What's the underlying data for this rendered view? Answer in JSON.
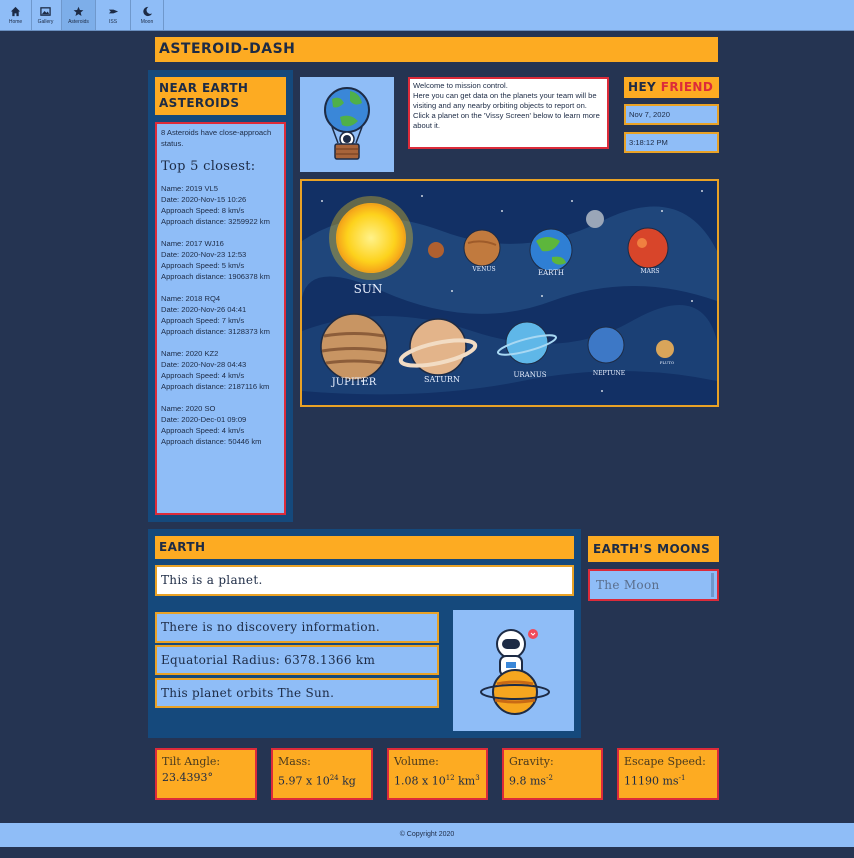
{
  "nav": {
    "items": [
      {
        "label": "Home",
        "icon": "home-icon"
      },
      {
        "label": "Gallery",
        "icon": "gallery-icon"
      },
      {
        "label": "Asteroids",
        "icon": "star-icon"
      },
      {
        "label": "ISS",
        "icon": "satellite-icon"
      },
      {
        "label": "Moon",
        "icon": "moon-icon"
      }
    ]
  },
  "app_title": "ASTEROID-DASH",
  "asteroids": {
    "heading": "NEAR EARTH ASTEROIDS",
    "summary": "8 Asteroids have close-approach status.",
    "top_label": "Top 5 closest:",
    "entries": [
      {
        "name": "Name: 2019 VL5",
        "date": "Date: 2020-Nov-15 10:26",
        "speed": "Approach Speed: 8 km/s",
        "distance": "Approach distance: 3259922 km"
      },
      {
        "name": "Name: 2017 WJ16",
        "date": "Date: 2020-Nov-23 12:53",
        "speed": "Approach Speed: 5 km/s",
        "distance": "Approach distance: 1906378 km"
      },
      {
        "name": "Name: 2018 RQ4",
        "date": "Date: 2020-Nov-26 04:41",
        "speed": "Approach Speed: 7 km/s",
        "distance": "Approach distance: 3128373 km"
      },
      {
        "name": "Name: 2020 KZ2",
        "date": "Date: 2020-Nov-28 04:43",
        "speed": "Approach Speed: 4 km/s",
        "distance": "Approach distance: 2187116 km"
      },
      {
        "name": "Name: 2020 SO",
        "date": "Date: 2020-Dec-01 09:09",
        "speed": "Approach Speed: 4 km/s",
        "distance": "Approach distance: 50446 km"
      }
    ]
  },
  "welcome": {
    "line1": "Welcome to mission control.",
    "line2": "Here you can get data on the planets your team will be visiting and any nearby orbiting objects to report on.",
    "line3": "Click a planet on the 'Vissy Screen' below to learn more about it."
  },
  "greeting": {
    "hey": "HEY",
    "name": "FRIEND"
  },
  "date": "Nov 7, 2020",
  "time": "3:18:12 PM",
  "solar_system": {
    "labels": [
      "SUN",
      "VENUS",
      "EARTH",
      "MARS",
      "JUPITER",
      "SATURN",
      "URANUS",
      "NEPTUNE",
      "PLUTO"
    ]
  },
  "planet": {
    "heading": "EARTH",
    "description": "This is a planet.",
    "discovery": "There is no discovery information.",
    "radius": "Equatorial Radius: 6378.1366 km",
    "orbits": "This planet orbits The Sun."
  },
  "moons": {
    "heading": "EARTH'S MOONS",
    "items": [
      "The Moon"
    ]
  },
  "stats": {
    "tilt": {
      "label": "Tilt Angle:",
      "value": "23.4393°"
    },
    "mass": {
      "label": "Mass:",
      "base": "5.97 x 10",
      "exp": "24",
      "unit": " kg"
    },
    "volume": {
      "label": "Volume:",
      "base": "1.08 x 10",
      "exp": "12",
      "unit": " km",
      "unit_exp": "3"
    },
    "gravity": {
      "label": "Gravity:",
      "base": "9.8 ms",
      "exp": "-2"
    },
    "escape": {
      "label": "Escape Speed:",
      "base": "11190 ms",
      "exp": "-1"
    }
  },
  "footer": "© Copyright 2020",
  "colors": {
    "accent": "#fdab22",
    "panel": "#15497c",
    "light": "#8fbdf7",
    "alert": "#dc2b3a",
    "bg": "#253452"
  }
}
